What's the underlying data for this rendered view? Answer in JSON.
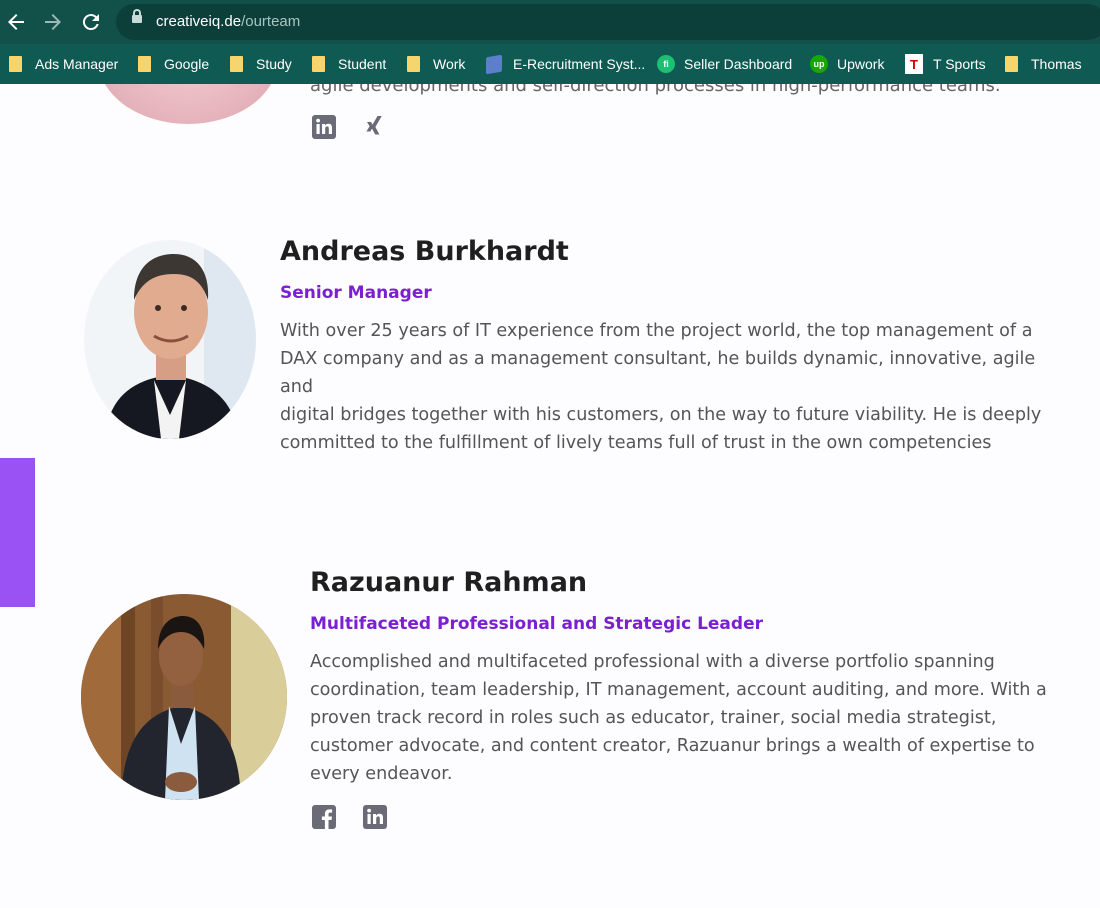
{
  "browser": {
    "url_domain": "creativeiq.de",
    "url_path": "/ourteam",
    "bookmarks": [
      {
        "label": "Ads Manager",
        "icon": "folder-icon"
      },
      {
        "label": "Google",
        "icon": "folder-icon"
      },
      {
        "label": "Study",
        "icon": "folder-icon"
      },
      {
        "label": "Student",
        "icon": "folder-icon"
      },
      {
        "label": "Work",
        "icon": "folder-icon"
      },
      {
        "label": "E-Recruitment Syst...",
        "icon": "book-icon"
      },
      {
        "label": "Seller Dashboard",
        "icon": "fiverr-icon",
        "icon_text": "fi"
      },
      {
        "label": "Upwork",
        "icon": "upwork-icon",
        "icon_text": "up"
      },
      {
        "label": "T Sports",
        "icon": "tsports-icon",
        "icon_text": "T"
      },
      {
        "label": "Thomas",
        "icon": "folder-icon"
      }
    ]
  },
  "team": {
    "partial_member": {
      "bio_tail": "agile developments and self-direction processes in high-performance teams.",
      "socials": [
        "linkedin-icon",
        "xing-icon"
      ]
    },
    "members": [
      {
        "name": "Andreas Burkhardt",
        "role": "Senior Manager",
        "bio_lines": [
          "With over 25 years of IT experience from the project world, the top management of a",
          "DAX company and as a management consultant, he builds dynamic, innovative, agile and",
          "digital bridges together with his customers, on the way to future viability. He is deeply",
          "committed to the fulfillment of lively teams full of trust in the own competencies"
        ]
      },
      {
        "name": "Razuanur Rahman",
        "role": "Multifaceted Professional and Strategic Leader",
        "bio_lines": [
          "Accomplished and multifaceted professional with a diverse portfolio spanning",
          "coordination, team leadership, IT management, account auditing, and more. With a",
          "proven track record in roles such as educator, trainer, social media strategist,",
          "customer advocate, and content creator, Razuanur brings a wealth of expertise to",
          "every endeavor."
        ],
        "socials": [
          "facebook-icon",
          "linkedin-icon"
        ]
      }
    ]
  },
  "colors": {
    "chrome_top": "#12504a",
    "bookmarks_bar": "#0f5a52",
    "role_purple": "#7a1fd2",
    "accent_tab": "#9a52f5"
  }
}
